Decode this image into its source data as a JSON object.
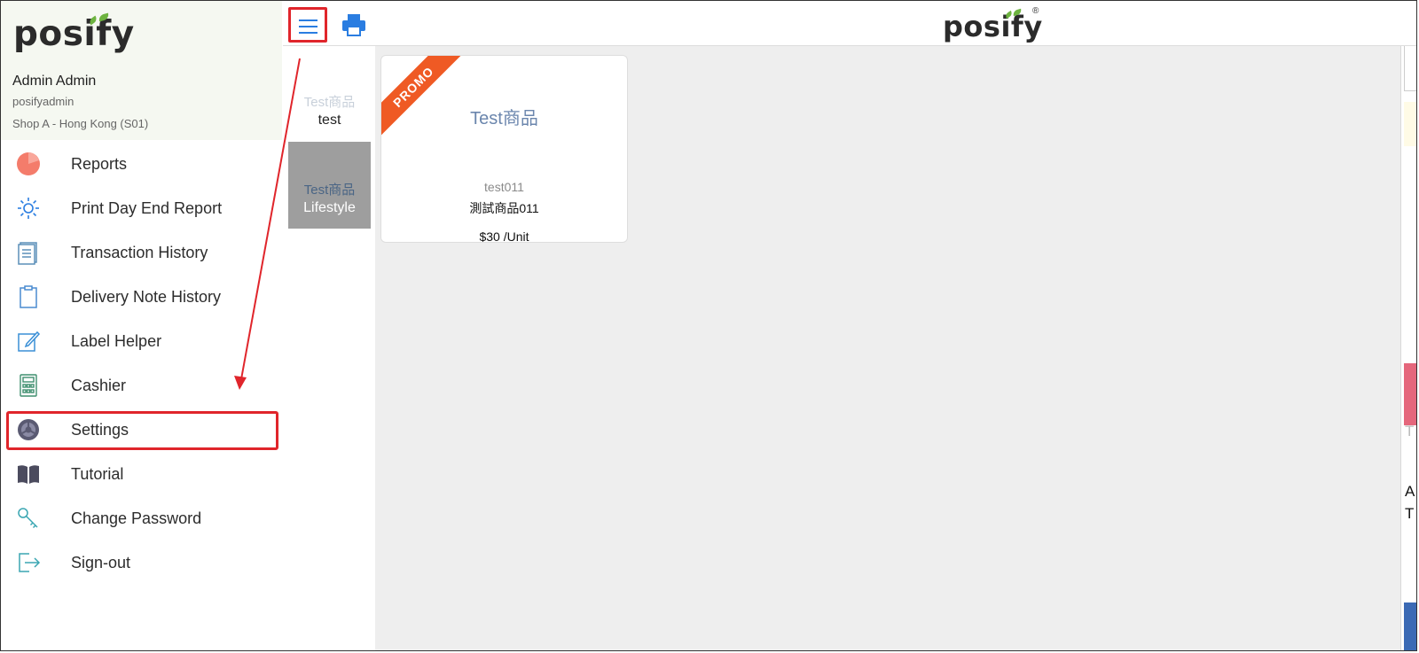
{
  "brand": {
    "logo_text": "posify",
    "registered_mark": "®"
  },
  "user": {
    "display_name": "Admin Admin",
    "username": "posifyadmin",
    "shop": "Shop A - Hong Kong (S01)"
  },
  "menu": [
    {
      "label": "Reports",
      "icon": "pie-chart-icon"
    },
    {
      "label": "Print Day End Report",
      "icon": "sun-icon"
    },
    {
      "label": "Transaction History",
      "icon": "document-list-icon"
    },
    {
      "label": "Delivery Note History",
      "icon": "clipboard-icon"
    },
    {
      "label": "Label Helper",
      "icon": "edit-note-icon"
    },
    {
      "label": "Cashier",
      "icon": "calculator-icon"
    },
    {
      "label": "Settings",
      "icon": "gear-icon"
    },
    {
      "label": "Tutorial",
      "icon": "book-icon"
    },
    {
      "label": "Change Password",
      "icon": "key-icon"
    },
    {
      "label": "Sign-out",
      "icon": "sign-out-icon"
    }
  ],
  "categories": [
    {
      "name": "Test商品",
      "sub": "test",
      "selected": false
    },
    {
      "name": "Test商品",
      "sub": "Lifestyle",
      "selected": true
    }
  ],
  "product": {
    "badge": "PROMO",
    "title": "Test商品",
    "code": "test011",
    "name": "測試商品011",
    "price": "$30 /Unit"
  },
  "right_edge": {
    "text_t1": "T",
    "text_a": "A",
    "text_t2": "T"
  },
  "colors": {
    "highlight": "#e0252b",
    "accent_blue": "#2a7de1",
    "promo": "#ef5a24",
    "leaf": "#6db33f"
  }
}
